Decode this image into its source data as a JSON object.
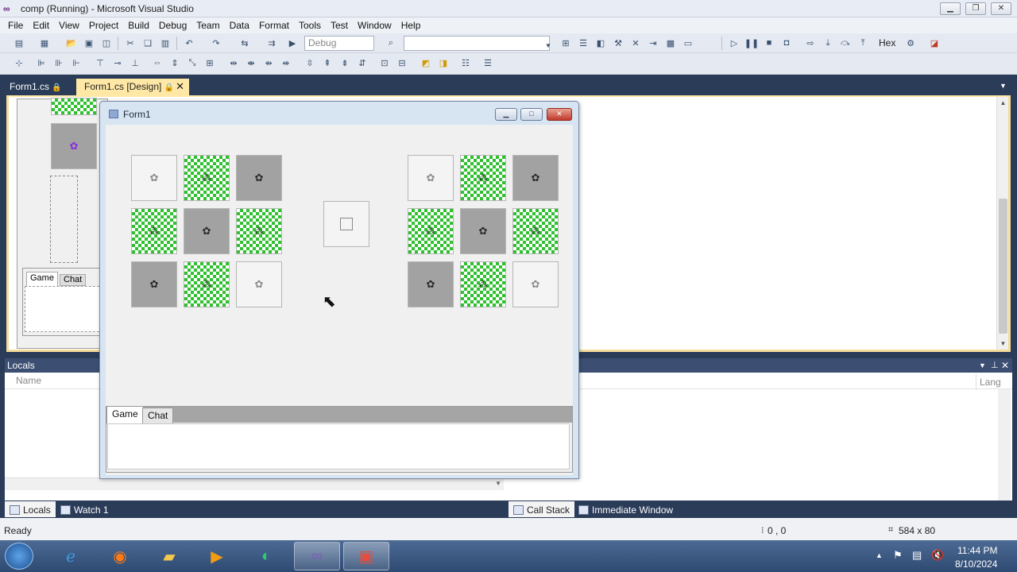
{
  "app": {
    "title": "comp (Running) - Microsoft Visual Studio"
  },
  "menu": [
    "File",
    "Edit",
    "View",
    "Project",
    "Build",
    "Debug",
    "Team",
    "Data",
    "Format",
    "Tools",
    "Test",
    "Window",
    "Help"
  ],
  "toolbar": {
    "config_value": "Debug",
    "hex_label": "Hex"
  },
  "doc_tabs": [
    {
      "label": "Form1.cs",
      "active": false
    },
    {
      "label": "Form1.cs [Design]",
      "active": true
    }
  ],
  "designer": {
    "tabs": [
      "Game",
      "Chat"
    ]
  },
  "form1": {
    "title": "Form1",
    "left_grid": [
      "light",
      "green",
      "dark",
      "green",
      "dark",
      "green",
      "dark",
      "green",
      "light"
    ],
    "right_grid": [
      "light",
      "green",
      "dark",
      "green",
      "dark",
      "green",
      "dark",
      "green",
      "light"
    ],
    "tabs": [
      "Game",
      "Chat"
    ]
  },
  "locals_panel": {
    "title": "Locals",
    "column_name": "Name",
    "column_lang": "Lang"
  },
  "bottom_tabs": {
    "left": [
      "Locals",
      "Watch 1"
    ],
    "right": [
      "Call Stack",
      "Immediate Window"
    ]
  },
  "status": {
    "text": "Ready",
    "position": "0 , 0",
    "size": "584 x 80"
  },
  "taskbar": {
    "time": "11:44 PM",
    "date": "8/10/2024"
  },
  "colors": {
    "chrome_dark": "#2b3c59",
    "active_doc_tab": "#ffe8a6",
    "tile_green": "#2fc02f",
    "tile_dark": "#a2a2a2"
  }
}
